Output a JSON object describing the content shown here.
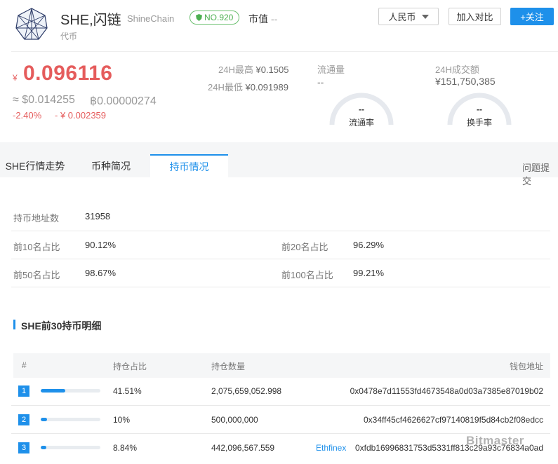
{
  "header": {
    "coin_name": "SHE,闪链",
    "coin_en": "ShineChain",
    "coin_type": "代币",
    "rank": "NO.920",
    "mcap_label": "市值",
    "mcap_value": "--",
    "currency_button": "人民币",
    "compare_button": "加入对比",
    "follow_button": "+关注"
  },
  "price": {
    "currency_symbol": "¥",
    "main": "0.096116",
    "usd": "≈ $0.014255",
    "btc": "฿0.00000274",
    "change_pct": "-2.40%",
    "change_abs": "- ¥ 0.002359"
  },
  "stats": {
    "high_label": "24H最高",
    "high_value": "¥0.1505",
    "low_label": "24H最低",
    "low_value": "¥0.091989",
    "circulation_label": "流通量",
    "circulation_value": "--",
    "volume_label": "24H成交额",
    "volume_value": "¥151,750,385",
    "gauge_circulation_value": "--",
    "gauge_circulation_label": "流通率",
    "gauge_turnover_value": "--",
    "gauge_turnover_label": "换手率"
  },
  "tabs": [
    {
      "label": "SHE行情走势"
    },
    {
      "label": "币种简况"
    },
    {
      "label": "持币情况"
    }
  ],
  "feedback_link": "问题提交",
  "holders": {
    "address_count_label": "持币地址数",
    "address_count_value": "31958",
    "top10_label": "前10名占比",
    "top10_value": "90.12%",
    "top20_label": "前20名占比",
    "top20_value": "96.29%",
    "top50_label": "前50名占比",
    "top50_value": "98.67%",
    "top100_label": "前100名占比",
    "top100_value": "99.21%"
  },
  "table": {
    "section_title": "SHE前30持币明细",
    "headers": [
      "#",
      "持仓占比",
      "持仓数量",
      "钱包地址"
    ],
    "rows": [
      {
        "rank": "1",
        "pct": "41.51%",
        "share": 0.4151,
        "amount": "2,075,659,052.998",
        "tag": "",
        "address": "0x0478e7d11553fd4673548a0d03a7385e87019b02"
      },
      {
        "rank": "2",
        "pct": "10%",
        "share": 0.1,
        "amount": "500,000,000",
        "tag": "",
        "address": "0x34ff45cf4626627cf97140819f5d84cb2f08edcc"
      },
      {
        "rank": "3",
        "pct": "8.84%",
        "share": 0.0884,
        "amount": "442,096,567.559",
        "tag": "Ethfinex",
        "address": "0xfdb16996831753d5331ff813c29a93c76834a0ad"
      }
    ]
  },
  "watermark": "Bitmaster",
  "colors": {
    "accent": "#1e90ea",
    "down": "#e55c5c",
    "rank_badge": "#4caf50"
  }
}
